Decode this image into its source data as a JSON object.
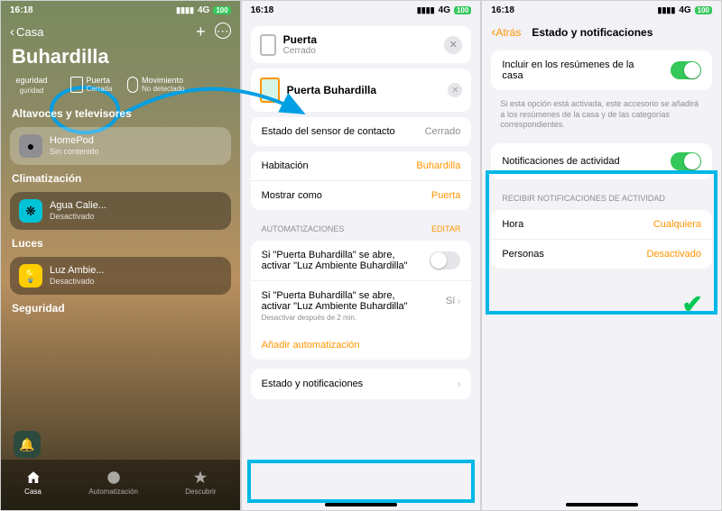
{
  "status": {
    "time": "16:18",
    "carrier": "4G",
    "battery": "100"
  },
  "phone1": {
    "back": "Casa",
    "title": "Buhardilla",
    "icons": {
      "security": {
        "label": "eguridad",
        "sub": "guridad"
      },
      "door": {
        "label": "Puerta",
        "sub": "Cerrada"
      },
      "motion": {
        "label": "Movimiento",
        "sub": "No detectado"
      }
    },
    "sections": {
      "speakers": "Altavoces y televisores",
      "climate": "Climatización",
      "lights": "Luces",
      "security": "Seguridad"
    },
    "tiles": {
      "homepod": {
        "name": "HomePod",
        "sub": "Sin contenido"
      },
      "agua": {
        "name": "Agua Calie...",
        "sub": "Desactivado"
      },
      "luz": {
        "name": "Luz Ambie...",
        "sub": "Desactivado"
      }
    },
    "tabs": {
      "home": "Casa",
      "auto": "Automatización",
      "discover": "Descubrir"
    }
  },
  "phone2": {
    "header": {
      "name": "Puerta",
      "state": "Cerrado"
    },
    "nameField": "Puerta Buhardilla",
    "sensorRow": {
      "label": "Estado del sensor de contacto",
      "value": "Cerrado"
    },
    "roomRow": {
      "label": "Habitación",
      "value": "Buhardilla"
    },
    "showAsRow": {
      "label": "Mostrar como",
      "value": "Puerta"
    },
    "autoHeader": "AUTOMATIZACIONES",
    "editLabel": "EDITAR",
    "auto1": "Si \"Puerta Buhardilla\" se abre, activar \"Luz Ambiente Buhardilla\"",
    "auto2": "Si \"Puerta Buhardilla\" se abre, activar \"Luz Ambiente Buhardilla\"",
    "auto2val": "Sí",
    "auto2sub": "Desactivar después de 2 min.",
    "addAuto": "Añadir automatización",
    "statusRow": "Estado y notificaciones"
  },
  "phone3": {
    "back": "Atrás",
    "title": "Estado y notificaciones",
    "includeRow": "Incluir en los resúmenes de la casa",
    "includeHint": "Si esta opción está activada, este accesorio se añadirá a los resúmenes de la casa y de las categorías correspondientes.",
    "activityRow": "Notificaciones de actividad",
    "recvHeader": "RECIBIR NOTIFICACIONES DE ACTIVIDAD",
    "timeRow": {
      "label": "Hora",
      "value": "Cualquiera"
    },
    "peopleRow": {
      "label": "Personas",
      "value": "Desactivado"
    }
  }
}
